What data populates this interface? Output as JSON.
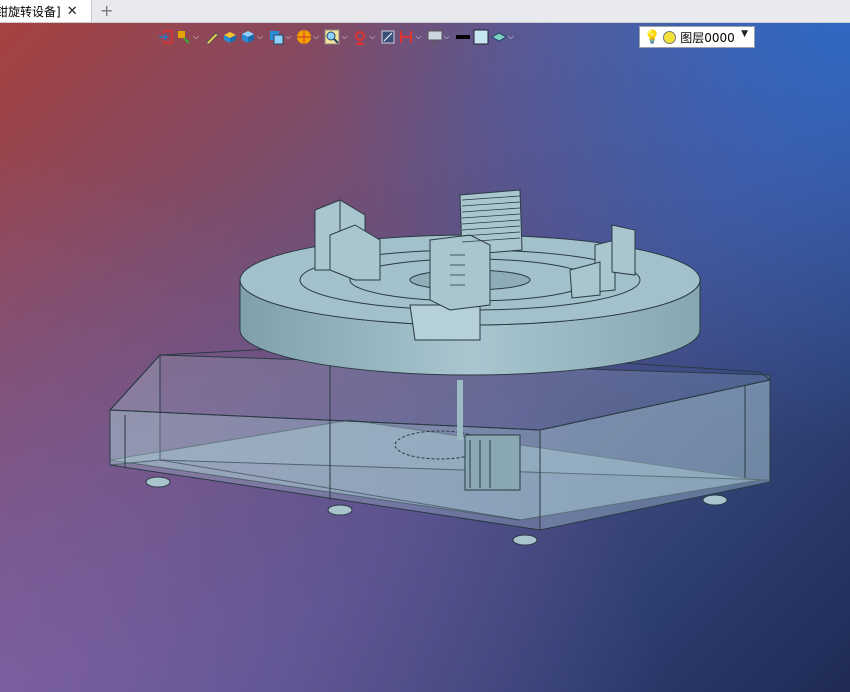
{
  "tab": {
    "title": "钳旋转设备]",
    "close_glyph": "✕",
    "add_glyph": "+"
  },
  "toolbar": {
    "items": [
      {
        "icon": "import-icon",
        "dropdown": false
      },
      {
        "icon": "paint-icon",
        "dropdown": true
      },
      {
        "icon": "pencil-icon",
        "dropdown": false
      },
      {
        "icon": "solid-box-icon",
        "dropdown": false
      },
      {
        "icon": "cube-icon",
        "dropdown": true
      },
      {
        "icon": "view-cube-icon",
        "dropdown": true
      },
      {
        "icon": "color-wheel-icon",
        "dropdown": true
      },
      {
        "icon": "zoom-icon",
        "dropdown": true
      },
      {
        "icon": "rotate-icon",
        "dropdown": true
      },
      {
        "icon": "section-icon",
        "dropdown": false
      },
      {
        "icon": "measure-icon",
        "dropdown": true
      },
      {
        "icon": "display-icon",
        "dropdown": true
      },
      {
        "icon": "line-color-icon",
        "dropdown": false
      },
      {
        "icon": "fill-color-icon",
        "dropdown": false
      },
      {
        "icon": "layer-stack-icon",
        "dropdown": true
      }
    ],
    "dropdown_glyph": "⌵"
  },
  "layer_select": {
    "bulb_glyph": "💡",
    "value": "图层0000",
    "arrow_glyph": "▼"
  },
  "colors": {
    "model_fill": "#9bbac4",
    "model_edge": "#2a3a44",
    "glass_fill": "#a9c9d2"
  }
}
